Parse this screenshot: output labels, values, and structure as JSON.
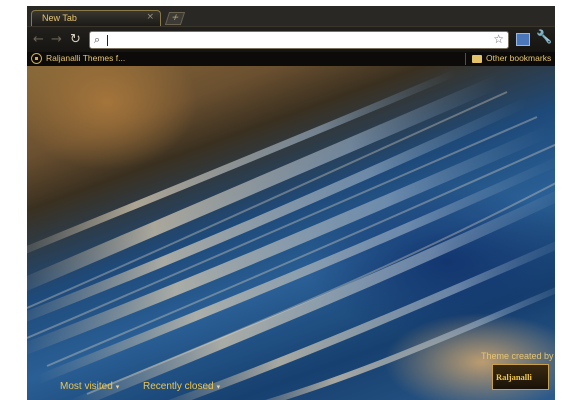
{
  "window": {
    "tab_title": "New Tab",
    "tab_close": "×",
    "new_tab_glyph": "+"
  },
  "toolbar": {
    "back_glyph": "←",
    "forward_glyph": "→",
    "reload_glyph": "↻",
    "search_glyph": "⌕",
    "star_glyph": "☆",
    "wrench_glyph": "🔧",
    "omnibox_value": ""
  },
  "bookmarks": {
    "items": [
      {
        "label": "Raljanalli Themes f...",
        "icon": "raljanalli-logo-icon"
      }
    ],
    "other_label": "Other bookmarks"
  },
  "ntp": {
    "most_visited_label": "Most visited",
    "recently_closed_label": "Recently closed",
    "caret_glyph": "▾",
    "theme_credit_label": "Theme created by",
    "theme_credit_brand": "Raljanalli"
  },
  "colors": {
    "accent": "#f0c64a",
    "frame": "#0a0907"
  }
}
